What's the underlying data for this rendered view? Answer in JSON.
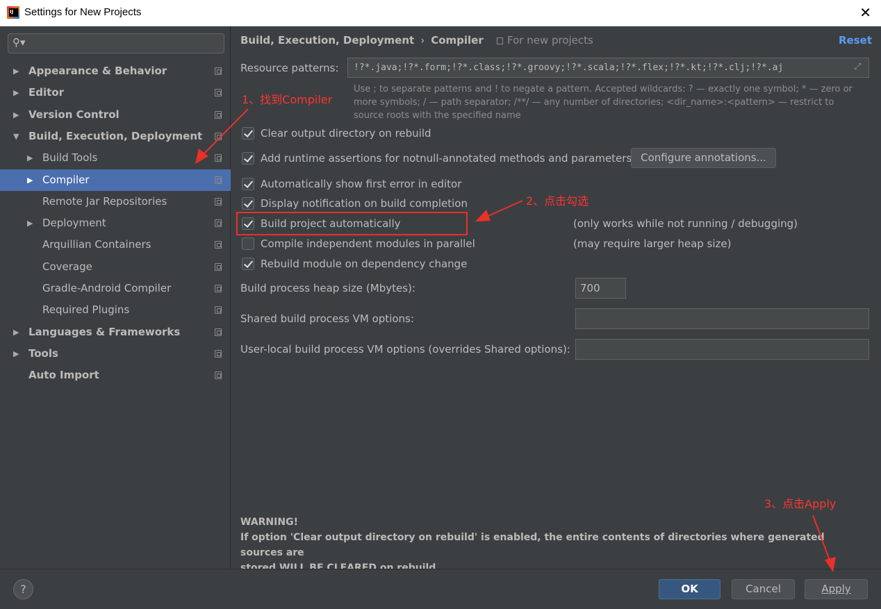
{
  "window": {
    "title": "Settings for New Projects"
  },
  "search": {
    "placeholder": ""
  },
  "tree": [
    {
      "label": "Appearance & Behavior",
      "level": 0,
      "expander": "collapsed",
      "bold": true
    },
    {
      "label": "Editor",
      "level": 0,
      "expander": "collapsed",
      "bold": true
    },
    {
      "label": "Version Control",
      "level": 0,
      "expander": "collapsed",
      "bold": true
    },
    {
      "label": "Build, Execution, Deployment",
      "level": 0,
      "expander": "expanded",
      "bold": true
    },
    {
      "label": "Build Tools",
      "level": 1,
      "expander": "collapsed",
      "bold": false
    },
    {
      "label": "Compiler",
      "level": 1,
      "expander": "collapsed",
      "bold": false,
      "selected": true
    },
    {
      "label": "Remote Jar Repositories",
      "level": 1,
      "expander": "none",
      "bold": false
    },
    {
      "label": "Deployment",
      "level": 1,
      "expander": "collapsed",
      "bold": false
    },
    {
      "label": "Arquillian Containers",
      "level": 1,
      "expander": "none",
      "bold": false
    },
    {
      "label": "Coverage",
      "level": 1,
      "expander": "none",
      "bold": false
    },
    {
      "label": "Gradle-Android Compiler",
      "level": 1,
      "expander": "none",
      "bold": false
    },
    {
      "label": "Required Plugins",
      "level": 1,
      "expander": "none",
      "bold": false
    },
    {
      "label": "Languages & Frameworks",
      "level": 0,
      "expander": "collapsed",
      "bold": true
    },
    {
      "label": "Tools",
      "level": 0,
      "expander": "collapsed",
      "bold": true
    },
    {
      "label": "Auto Import",
      "level": 0,
      "expander": "none",
      "bold": true
    }
  ],
  "header": {
    "breadcrumb_parent": "Build, Execution, Deployment",
    "breadcrumb_sep": "›",
    "breadcrumb_current": "Compiler",
    "scope": "For new projects",
    "reset": "Reset"
  },
  "resource_patterns": {
    "label": "Resource patterns:",
    "value": "!?*.java;!?*.form;!?*.class;!?*.groovy;!?*.scala;!?*.flex;!?*.kt;!?*.clj;!?*.aj",
    "hint_1": "Use ; to separate patterns and ! to negate a pattern. Accepted wildcards: ? — exactly one symbol; * — zero or",
    "hint_2": "more symbols; / — path separator; /**/ — any number of directories; <dir_name>:<pattern> — restrict to",
    "hint_3": "source roots with the specified name"
  },
  "options": [
    {
      "label": "Clear output directory on rebuild",
      "checked": true
    },
    {
      "label": "Add runtime assertions for notnull-annotated methods and parameters",
      "checked": true
    },
    {
      "label": "Automatically show first error in editor",
      "checked": true
    },
    {
      "label": "Display notification on build completion",
      "checked": true
    },
    {
      "label": "Build project automatically",
      "checked": true,
      "note": "(only works while not running / debugging)"
    },
    {
      "label": "Compile independent modules in parallel",
      "checked": false,
      "note": "(may require larger heap size)"
    },
    {
      "label": "Rebuild module on dependency change",
      "checked": true
    }
  ],
  "configure_annotations": "Configure annotations...",
  "heap": {
    "label": "Build process heap size (Mbytes):",
    "value": "700"
  },
  "shared_vm": {
    "label": "Shared build process VM options:",
    "value": ""
  },
  "user_vm": {
    "label": "User-local build process VM options (overrides Shared options):",
    "value": ""
  },
  "warning": {
    "title": "WARNING!",
    "line_1": "If option 'Clear output directory on rebuild' is enabled, the entire contents of directories where generated sources are",
    "line_2": "stored WILL BE CLEARED on rebuild."
  },
  "footer": {
    "help": "?",
    "ok": "OK",
    "cancel": "Cancel",
    "apply": "Apply"
  },
  "annotations": {
    "step1": "1、找到Compiler",
    "step2": "2、点击勾选",
    "step3": "3、点击Apply"
  },
  "colors": {
    "background": "#3c3f41",
    "selection": "#4b6eaf",
    "link": "#589df6",
    "annotation": "#ff3333",
    "primary_button": "#365880"
  }
}
